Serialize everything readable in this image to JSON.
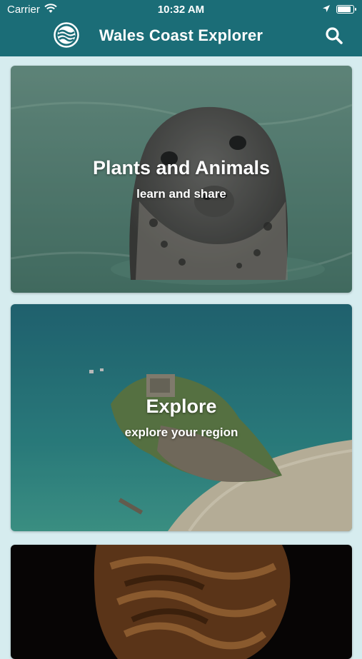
{
  "status_bar": {
    "carrier": "Carrier",
    "time": "10:32 AM",
    "battery_level": 0.95
  },
  "header": {
    "title": "Wales Coast Explorer",
    "logo_icon": "wave-logo-icon",
    "search_icon": "search-icon",
    "background_color": "#1b6d77"
  },
  "cards": [
    {
      "title": "Plants and Animals",
      "subtitle": "learn and share",
      "image": "grey-seal-photo"
    },
    {
      "title": "Explore",
      "subtitle": "explore your region",
      "image": "island-aerial-photo"
    },
    {
      "title": "",
      "subtitle": "",
      "image": "sculpture-photo"
    }
  ]
}
